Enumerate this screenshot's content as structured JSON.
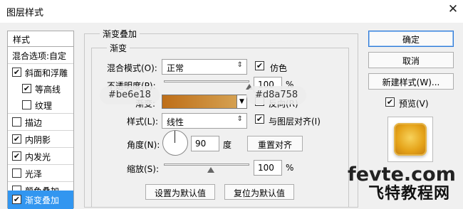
{
  "window": {
    "title": "图层样式",
    "close_glyph": "✕"
  },
  "styles_list": {
    "header": "样式",
    "blend_options": "混合选项:自定",
    "items": [
      {
        "label": "斜面和浮雕",
        "checked": true
      },
      {
        "label": "等高线",
        "checked": true
      },
      {
        "label": "纹理",
        "checked": false
      },
      {
        "label": "描边",
        "checked": false
      },
      {
        "label": "内阴影",
        "checked": true
      },
      {
        "label": "内发光",
        "checked": true
      },
      {
        "label": "光泽",
        "checked": false
      },
      {
        "label": "颜色叠加",
        "checked": false
      },
      {
        "label": "渐变叠加",
        "checked": true,
        "selected": true
      }
    ]
  },
  "panel": {
    "group_title": "渐变叠加",
    "subgroup_title": "渐变",
    "blend_mode": {
      "label": "混合模式(O):",
      "value": "正常"
    },
    "dither": {
      "label": "仿色",
      "checked": true
    },
    "opacity": {
      "label": "不透明度(P):",
      "value": "100",
      "unit": "%",
      "slider_level": 1.0
    },
    "gradient": {
      "label": "渐变:",
      "color_start": "#be6e18",
      "color_end": "#d8a758"
    },
    "reverse": {
      "label": "反向(R)",
      "checked": false
    },
    "style": {
      "label": "样式(L):",
      "value": "线性"
    },
    "align": {
      "label": "与图层对齐(I)",
      "checked": true
    },
    "angle": {
      "label": "角度(N):",
      "value": "90",
      "unit": "度"
    },
    "reset_align": "重置对齐",
    "scale": {
      "label": "缩放(S):",
      "value": "100",
      "unit": "%",
      "slider_level": 0.55
    },
    "make_default": "设置为默认值",
    "reset_default": "复位为默认值"
  },
  "color_pills": {
    "start": "#be6e18",
    "end": "#d8a758"
  },
  "buttons": {
    "ok": "确定",
    "cancel": "取消",
    "new_style": "新建样式(W)..."
  },
  "preview": {
    "label": "预览(V)",
    "checked": true
  },
  "watermark": {
    "line1": "fevte.com",
    "line2": "飞特教程网"
  },
  "colors": {
    "accent": "#3296f0",
    "selected_row": "#3296f0"
  }
}
